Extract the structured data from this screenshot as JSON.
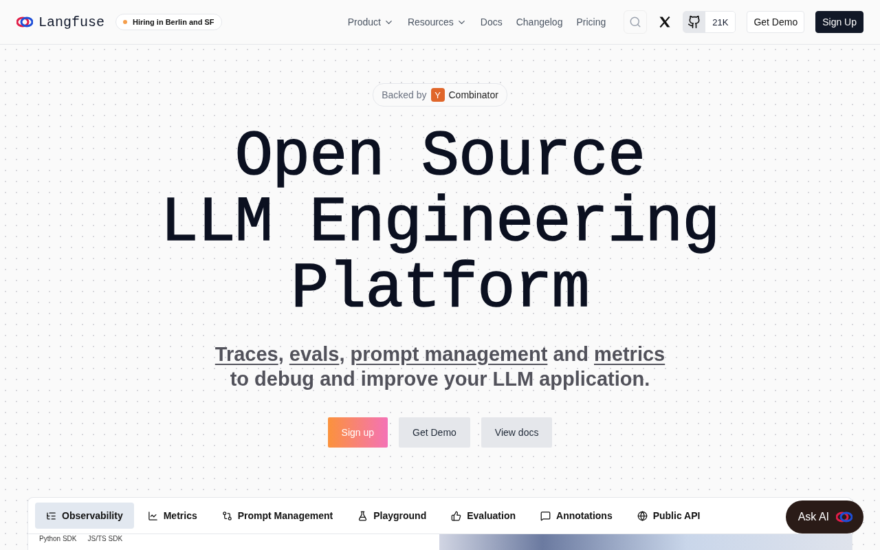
{
  "nav": {
    "brand": "Langfuse",
    "hiring_badge": "Hiring in Berlin and SF",
    "links": [
      {
        "label": "Product",
        "dropdown": true
      },
      {
        "label": "Resources",
        "dropdown": true
      },
      {
        "label": "Docs",
        "dropdown": false
      },
      {
        "label": "Changelog",
        "dropdown": false
      },
      {
        "label": "Pricing",
        "dropdown": false
      }
    ],
    "github_stars": "21K",
    "demo_button": "Get Demo",
    "signup_button": "Sign Up"
  },
  "backed_by": {
    "prefix": "Backed by",
    "logo_letter": "Y",
    "name": "Combinator"
  },
  "hero": {
    "title_lines": [
      "Open Source",
      "LLM Engineering",
      "Platform"
    ],
    "subtitle": [
      {
        "kind": "link",
        "text": "Traces"
      },
      {
        "kind": "text",
        "text": ", "
      },
      {
        "kind": "link",
        "text": "evals"
      },
      {
        "kind": "text",
        "text": ", "
      },
      {
        "kind": "link",
        "text": "prompt management"
      },
      {
        "kind": "text",
        "text": " and "
      },
      {
        "kind": "link",
        "text": "metrics"
      },
      {
        "kind": "break"
      },
      {
        "kind": "text",
        "text": "to debug and improve your LLM application."
      }
    ],
    "buttons": [
      {
        "label": "Sign up",
        "kind": "primary"
      },
      {
        "label": "Get Demo",
        "kind": "secondary"
      },
      {
        "label": "View docs",
        "kind": "secondary"
      }
    ]
  },
  "feature_tabs": [
    {
      "label": "Observability",
      "selected": true
    },
    {
      "label": "Metrics",
      "selected": false
    },
    {
      "label": "Prompt Management",
      "selected": false
    },
    {
      "label": "Playground",
      "selected": false
    },
    {
      "label": "Evaluation",
      "selected": false
    },
    {
      "label": "Annotations",
      "selected": false
    },
    {
      "label": "Public API",
      "selected": false
    }
  ],
  "sdk_tabs": [
    "Python SDK",
    "JS/TS SDK"
  ],
  "ask_ai": "Ask AI"
}
